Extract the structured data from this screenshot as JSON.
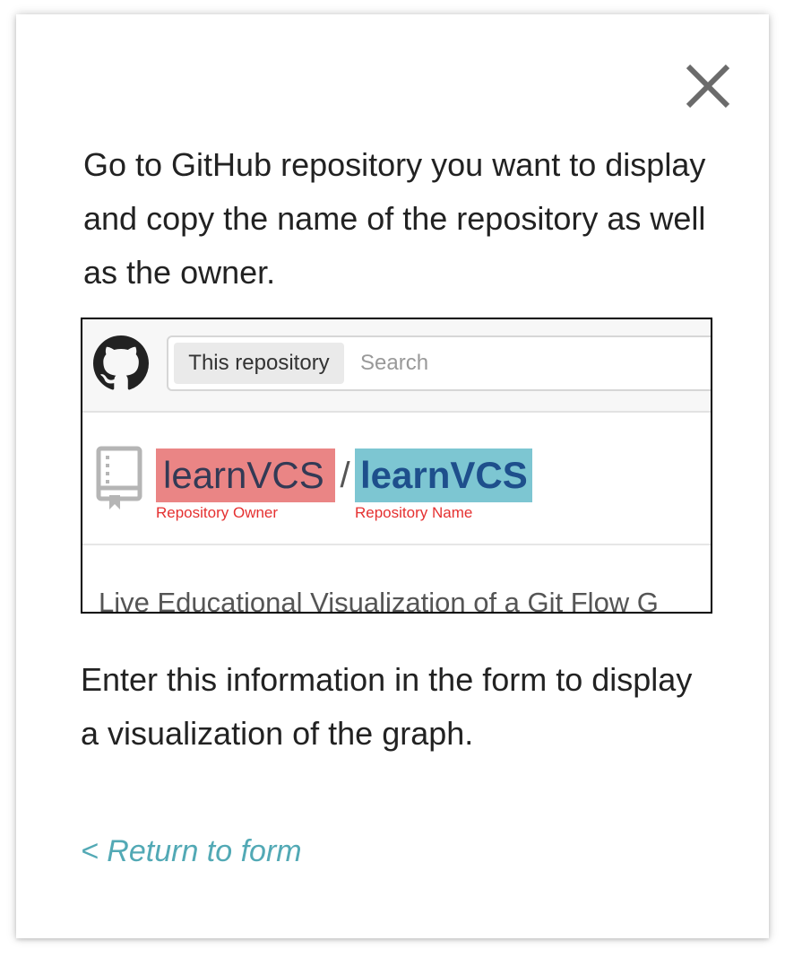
{
  "dialog": {
    "close_icon": "close-icon",
    "intro_text": "Go to GitHub repository you want to display and copy the name of the repository as well as the owner.",
    "outro_text": "Enter this information in the form to display a visualization of the graph.",
    "return_link_label": "< Return to form"
  },
  "example": {
    "logo_icon": "github-octocat-icon",
    "search_scope": "This repository",
    "search_placeholder": "Search",
    "repo_icon": "repo-book-icon",
    "owner": "learnVCS",
    "separator": "/",
    "name": "learnVCS",
    "owner_caption": "Repository Owner",
    "name_caption": "Repository Name",
    "description": "Live Educational Visualization of a Git Flow G"
  },
  "colors": {
    "owner_highlight": "#ea8585",
    "name_highlight": "#7dc6d2",
    "caption_red": "#e53030",
    "link": "#52a9b5"
  }
}
